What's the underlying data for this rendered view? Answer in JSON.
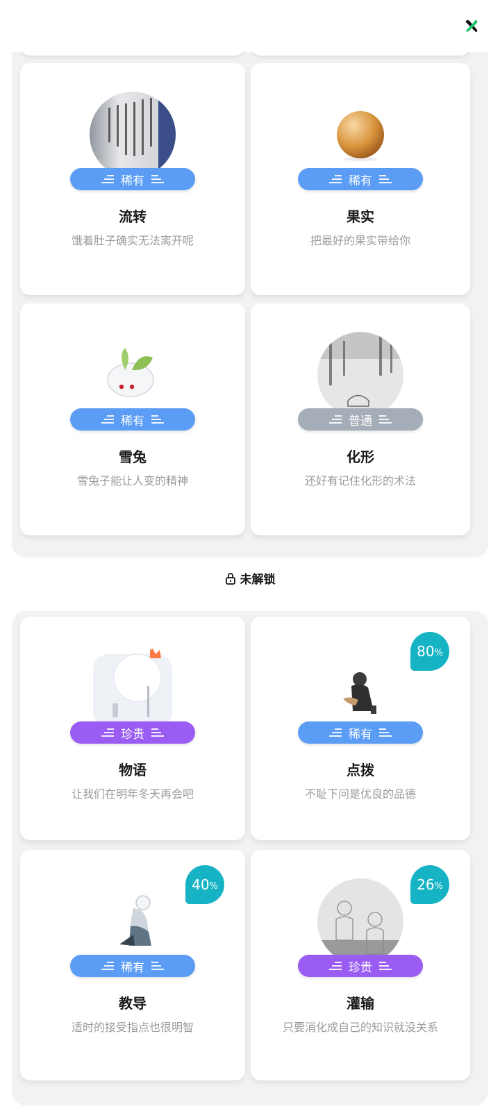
{
  "colors": {
    "rare": "#5b9cf5",
    "common": "#a5adb8",
    "precious": "#9a5cf2",
    "percent": "#16b3c4",
    "close_icon": "#1fc56a"
  },
  "unlocked_cards": [
    {
      "name": "流转",
      "desc": "饿着肚子确实无法离开呢",
      "rarity": "稀有",
      "icon": "handwritten-poem-scroll-icon"
    },
    {
      "name": "果实",
      "desc": "把最好的果实带给你",
      "rarity": "稀有",
      "icon": "orange-fruit-icon"
    },
    {
      "name": "雪兔",
      "desc": "雪兔子能让人变的精神",
      "rarity": "稀有",
      "icon": "snow-bunny-icon"
    },
    {
      "name": "化形",
      "desc": "还好有记住化形的术法",
      "rarity": "普通",
      "icon": "misty-forest-icon"
    }
  ],
  "locked_section": {
    "title": "未解锁",
    "icon": "lock-icon"
  },
  "locked_cards": [
    {
      "name": "物语",
      "desc": "让我们在明年冬天再会吧",
      "rarity": "珍贵",
      "progress": null,
      "icon": "snowy-tree-icon"
    },
    {
      "name": "点拨",
      "desc": "不耻下问是优良的品德",
      "rarity": "稀有",
      "progress": "80",
      "icon": "sitting-figure-icon"
    },
    {
      "name": "教导",
      "desc": "适时的接受指点也很明智",
      "rarity": "稀有",
      "progress": "40",
      "icon": "kneeling-figure-icon"
    },
    {
      "name": "灌输",
      "desc": "只要消化成自己的知识就没关系",
      "rarity": "珍贵",
      "progress": "26",
      "icon": "sketch-figures-icon"
    }
  ],
  "percent_sign": "%"
}
